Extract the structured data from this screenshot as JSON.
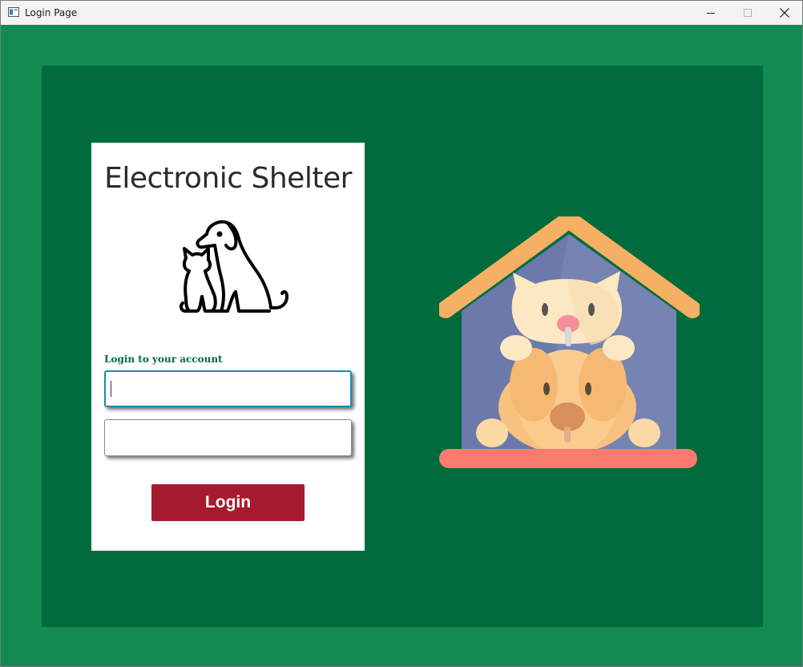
{
  "window": {
    "title": "Login Page"
  },
  "card": {
    "title": "Electronic Shelter",
    "login_label": "Login to your account",
    "username": {
      "value": "",
      "placeholder": ""
    },
    "password": {
      "value": "",
      "placeholder": ""
    },
    "login_button": "Login"
  },
  "colors": {
    "outer_background": "#138a52",
    "panel_background": "#006b3c",
    "card_background": "#ffffff",
    "login_button": "#a51a2e",
    "focus_border": "#1d8ab3"
  },
  "icons": {
    "logo": "dog-and-cat-icon",
    "illustration": "pet-house-icon"
  }
}
